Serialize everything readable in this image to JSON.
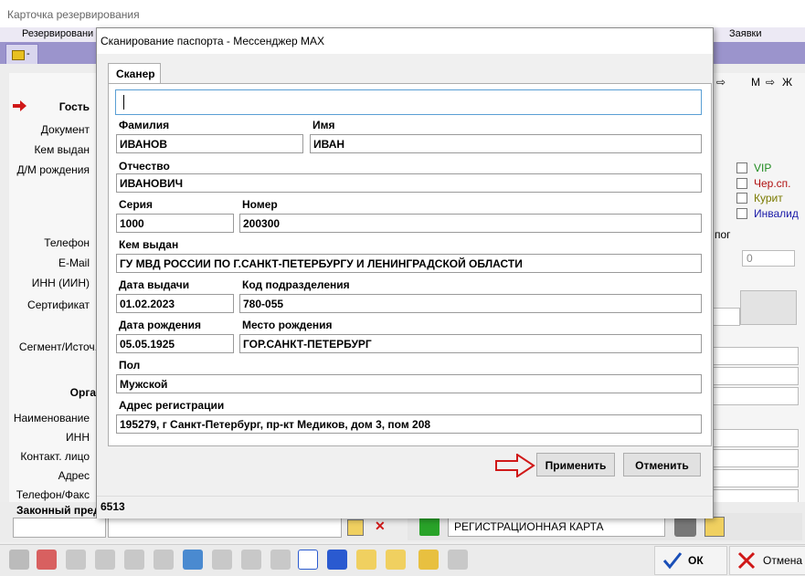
{
  "background": {
    "window_title": "Карточка резервирования",
    "menu_left": "Резервировани",
    "menu_right": "Заявки",
    "tab_dash": "-",
    "nav_label": "М",
    "nav_label2": "Ж",
    "left_labels": [
      "Гость",
      "Документ",
      "Кем выдан",
      "Д/М рождения",
      "Телефон",
      "E-Mail",
      "ИНН (ИИН)",
      "Сертификат",
      "Сегмент/Источ."
    ],
    "org_section": "Орга",
    "org_labels": [
      "Наименование",
      "ИНН",
      "Контакт. лицо",
      "Адрес",
      "Телефон/Факс"
    ],
    "legal_label": "Законный пред",
    "right_flags": [
      {
        "label": "VIP",
        "color": "#1e8a1e"
      },
      {
        "label": "Чер.сп.",
        "color": "#b01010"
      },
      {
        "label": "Курит",
        "color": "#7a7a00"
      },
      {
        "label": "Инвалид",
        "color": "#1a1aa8"
      }
    ],
    "right_tab": "пог",
    "right_counter": "0",
    "reg_card": "РЕГИСТРАЦИОННАЯ КАРТА",
    "ok_label": "ОК",
    "cancel_label": "Отмена"
  },
  "dialog": {
    "title": "Сканирование паспорта - Мессенджер MAX",
    "tab": "Сканер",
    "fields": {
      "surname": {
        "label": "Фамилия",
        "value": "ИВАНОВ"
      },
      "name": {
        "label": "Имя",
        "value": "ИВАН"
      },
      "patronymic": {
        "label": "Отчество",
        "value": "ИВАНОВИЧ"
      },
      "series": {
        "label": "Серия",
        "value": "1000"
      },
      "number": {
        "label": "Номер",
        "value": "200300"
      },
      "issued_by": {
        "label": "Кем выдан",
        "value": "ГУ МВД РОССИИ ПО Г.САНКТ-ПЕТЕРБУРГУ И ЛЕНИНГРАДСКОЙ ОБЛАСТИ"
      },
      "issue_date": {
        "label": "Дата выдачи",
        "value": "01.02.2023"
      },
      "dept_code": {
        "label": "Код подразделения",
        "value": "780-055"
      },
      "birth_date": {
        "label": "Дата рождения",
        "value": "05.05.1925"
      },
      "birth_place": {
        "label": "Место рождения",
        "value": "ГОР.САНКТ-ПЕТЕРБУРГ"
      },
      "gender": {
        "label": "Пол",
        "value": "Мужской"
      },
      "address": {
        "label": "Адрес регистрации",
        "value": "195279, г Санкт-Петербург, пр-кт Медиков, дом 3, пом 208"
      }
    },
    "apply_label": "Применить",
    "cancel_label": "Отменить",
    "status": "6513"
  },
  "colors": {
    "accent": "#5a9fd4",
    "arrow": "#d01818",
    "ok_check": "#1a4fb8",
    "cancel_x": "#d01818"
  }
}
